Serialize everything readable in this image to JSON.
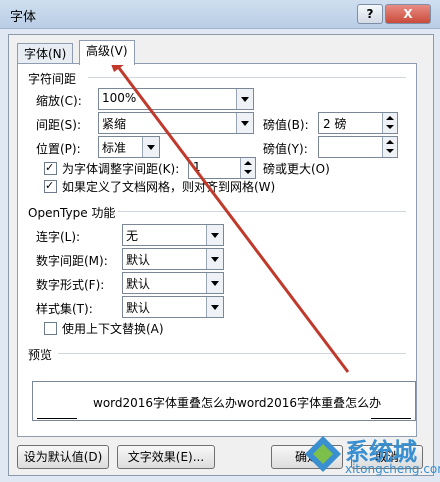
{
  "window": {
    "title": "字体",
    "help_label": "?",
    "close_label": "X"
  },
  "tabs": [
    {
      "label": "字体(N)"
    },
    {
      "label": "高级(V)"
    }
  ],
  "char_spacing": {
    "section": "字符间距",
    "scale_label": "缩放(C):",
    "scale_value": "100%",
    "spacing_label": "间距(S):",
    "spacing_value": "紧缩",
    "spacing_pts_label": "磅值(B):",
    "spacing_pts_value": "2 磅",
    "position_label": "位置(P):",
    "position_value": "标准",
    "position_pts_label": "磅值(Y):",
    "position_pts_value": "",
    "kerning_label": "为字体调整字间距(K):",
    "kerning_value": "1",
    "kerning_suffix": "磅或更大(O)",
    "grid_label": "如果定义了文档网格，则对齐到网格(W)"
  },
  "opentype": {
    "section": "OpenType 功能",
    "ligatures_label": "连字(L):",
    "ligatures_value": "无",
    "num_spacing_label": "数字间距(M):",
    "num_spacing_value": "默认",
    "num_forms_label": "数字形式(F):",
    "num_forms_value": "默认",
    "style_sets_label": "样式集(T):",
    "style_sets_value": "默认",
    "contextual_label": "使用上下文替换(A)"
  },
  "preview": {
    "section": "预览",
    "text": "word2016字体重叠怎么办word2016字体重叠怎么办"
  },
  "footer": {
    "default_button": "设为默认值(D)",
    "effects_button": "文字效果(E)...",
    "ok_button": "确定",
    "cancel_button": "取消"
  },
  "watermark": {
    "brand": "系统城",
    "url": "xitongcheng.com"
  },
  "colors": {
    "accent_arrow": "#c0392b",
    "watermark": "#3a8fd0"
  }
}
